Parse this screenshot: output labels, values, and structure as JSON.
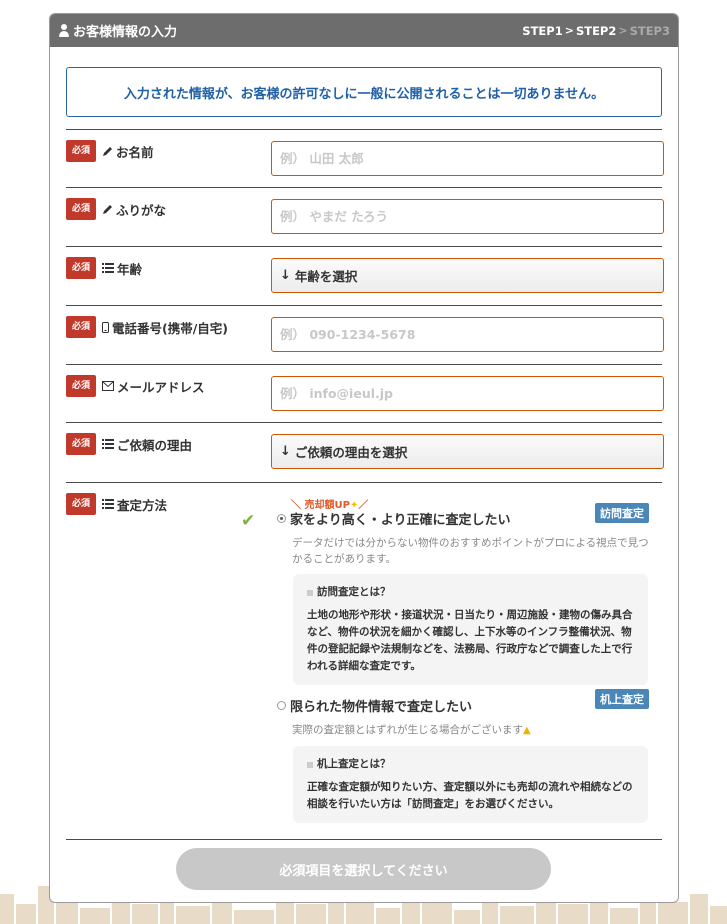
{
  "header": {
    "title": "お客様情報の入力",
    "steps": [
      "STEP1",
      "STEP2",
      "STEP3"
    ],
    "chevron": ">"
  },
  "notice": "入力された情報が、お客様の許可なしに一般に公開されることは一切ありません。",
  "required_label": "必須",
  "fields": {
    "name": {
      "label": "お名前",
      "placeholder": "例） 山田 太郎",
      "icon": "pencil-icon"
    },
    "furigana": {
      "label": "ふりがな",
      "placeholder": "例） やまだ たろう",
      "icon": "pencil-icon"
    },
    "age": {
      "label": "年齢",
      "select_value": "年齢を選択",
      "icon": "list-icon"
    },
    "phone": {
      "label": "電話番号(携帯/自宅)",
      "placeholder": "例） 090-1234-5678",
      "icon": "mobile-icon"
    },
    "email": {
      "label": "メールアドレス",
      "placeholder": "例） info@ieul.jp",
      "icon": "envelope-icon"
    },
    "reason": {
      "label": "ご依頼の理由",
      "select_value": "ご依頼の理由を選択",
      "icon": "list-icon"
    }
  },
  "method": {
    "label": "査定方法",
    "up_note": "＼ 売却額UP",
    "up_note_tail": "／",
    "option1": {
      "label": "家をより高く・より正確に査定したい",
      "badge": "訪問査定",
      "desc": "データだけでは分からない物件のおすすめポイントがプロによる視点で見つかることがあります。",
      "info_title": "訪問査定とは？",
      "info_body": "土地の地形や形状・接道状況・日当たり・周辺施設・建物の傷み具合など、物件の状況を細かく確認し、上下水等のインフラ整備状況、物件の登記記録や法規制などを、法務局、行政庁などで調査した上で行われる詳細な査定です。",
      "selected": true
    },
    "option2": {
      "label": "限られた物件情報で査定したい",
      "badge": "机上査定",
      "desc": "実際の査定額とはずれが生じる場合がございます",
      "info_title": "机上査定とは？",
      "info_body": "正確な査定額が知りたい方、査定額以外にも売却の流れや相続などの相談を行いたい方は「訪問査定」をお選びください。",
      "selected": false
    }
  },
  "submit_label": "必須項目を選択してください",
  "colors": {
    "header_bg": "#6d6d6d",
    "required_bg": "#c0392b",
    "field_border": "#d35400",
    "notice_blue": "#2060a8",
    "badge_blue": "#4a86b8",
    "check_green": "#7cb342",
    "submit_disabled": "#c8c8c8"
  }
}
